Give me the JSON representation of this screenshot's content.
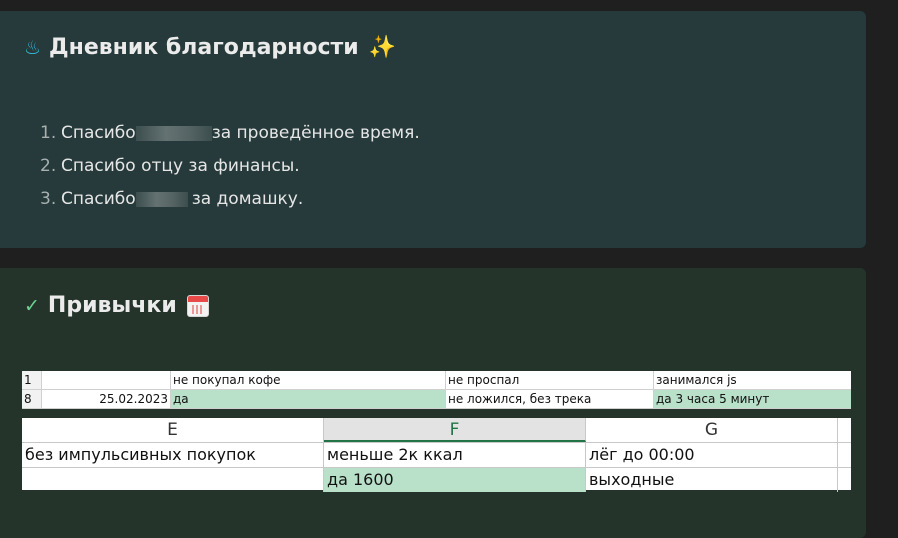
{
  "gratitude": {
    "icon": "flame-icon",
    "title": "Дневник благодарности",
    "title_icon": "sparkles-icon",
    "items": [
      {
        "number": "1.",
        "before": "Спасибо",
        "after": "за проведённое время."
      },
      {
        "number": "2.",
        "before": "Спасибо отцу за финансы.",
        "after": ""
      },
      {
        "number": "3.",
        "before": "Спасибо",
        "after": "за домашку."
      }
    ]
  },
  "habits": {
    "icon": "check-icon",
    "title": "Привычки",
    "title_icon": "calendar-icon"
  },
  "sheet_small": {
    "rows": [
      {
        "row": "1",
        "date": "",
        "b": "не покупал кофе",
        "c": "не проспал",
        "d": "занимался js"
      },
      {
        "row": "8",
        "date": "25.02.2023",
        "b": "да",
        "c": "не ложился, без трека",
        "d": "да 3 часа 5 минут"
      }
    ]
  },
  "sheet_large": {
    "columns": [
      "E",
      "F",
      "G"
    ],
    "selected_column": "F",
    "rows": [
      [
        "без импульсивных покупок",
        "меньше 2к ккал",
        "лёг до 00:00"
      ],
      [
        "",
        "да 1600",
        "выходные"
      ]
    ]
  },
  "colors": {
    "highlight": "#b9e0c8",
    "selected_header": "#217346"
  }
}
